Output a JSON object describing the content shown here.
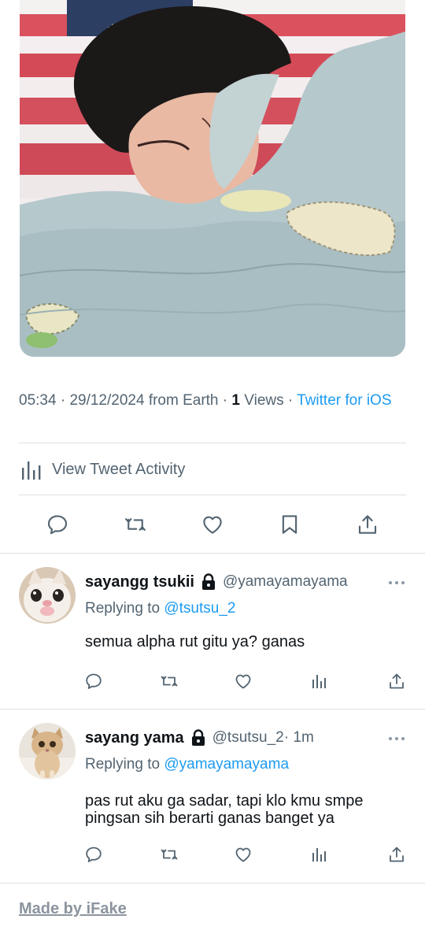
{
  "tweet": {
    "time": "05:34",
    "date": "29/12/2024",
    "location": "from Earth",
    "views_count": "1",
    "views_label": "Views",
    "source": "Twitter for iOS",
    "activity_label": "View Tweet Activity"
  },
  "actions": [
    "reply-icon",
    "retweet-icon",
    "like-icon",
    "bookmark-icon",
    "share-icon"
  ],
  "replies": [
    {
      "name": "sayangg tsukii",
      "handle": "@yamayamayama",
      "time": "",
      "replying_prefix": "Replying to",
      "replying_to": "@tsutsu_2",
      "text": "semua alpha rut gitu ya? ganas",
      "avatar": "cat-face-avatar"
    },
    {
      "name": "sayang yama",
      "handle": "@tsutsu_2",
      "time": " · 1m",
      "replying_prefix": "Replying to",
      "replying_to": "@yamayamayama",
      "text": "pas rut aku ga sadar, tapi klo kmu smpe pingsan sih berarti ganas banget ya",
      "avatar": "kitten-avatar"
    }
  ],
  "footer": "Made by iFake",
  "colors": {
    "accent": "#1d9bf0",
    "muted": "#536471",
    "text": "#0f1419",
    "divider": "#dcdfe2"
  }
}
